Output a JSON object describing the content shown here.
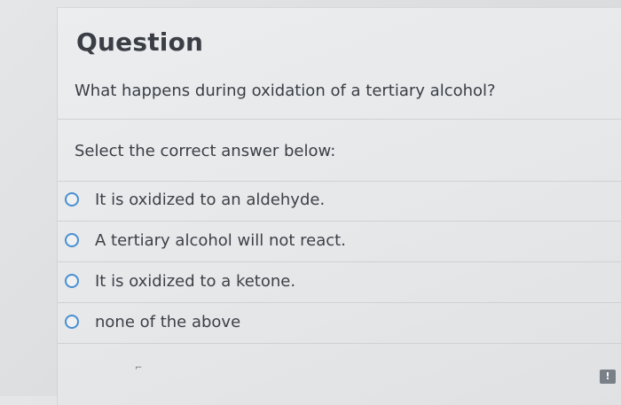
{
  "question": {
    "heading": "Question",
    "text": "What happens during oxidation of a tertiary alcohol?",
    "prompt": "Select the correct answer below:",
    "options": [
      {
        "label": "It is oxidized to an aldehyde."
      },
      {
        "label": "A tertiary alcohol will not react."
      },
      {
        "label": "It is oxidized to a ketone."
      },
      {
        "label": "none of the above"
      }
    ]
  },
  "footer": {
    "flag_label": "!"
  }
}
